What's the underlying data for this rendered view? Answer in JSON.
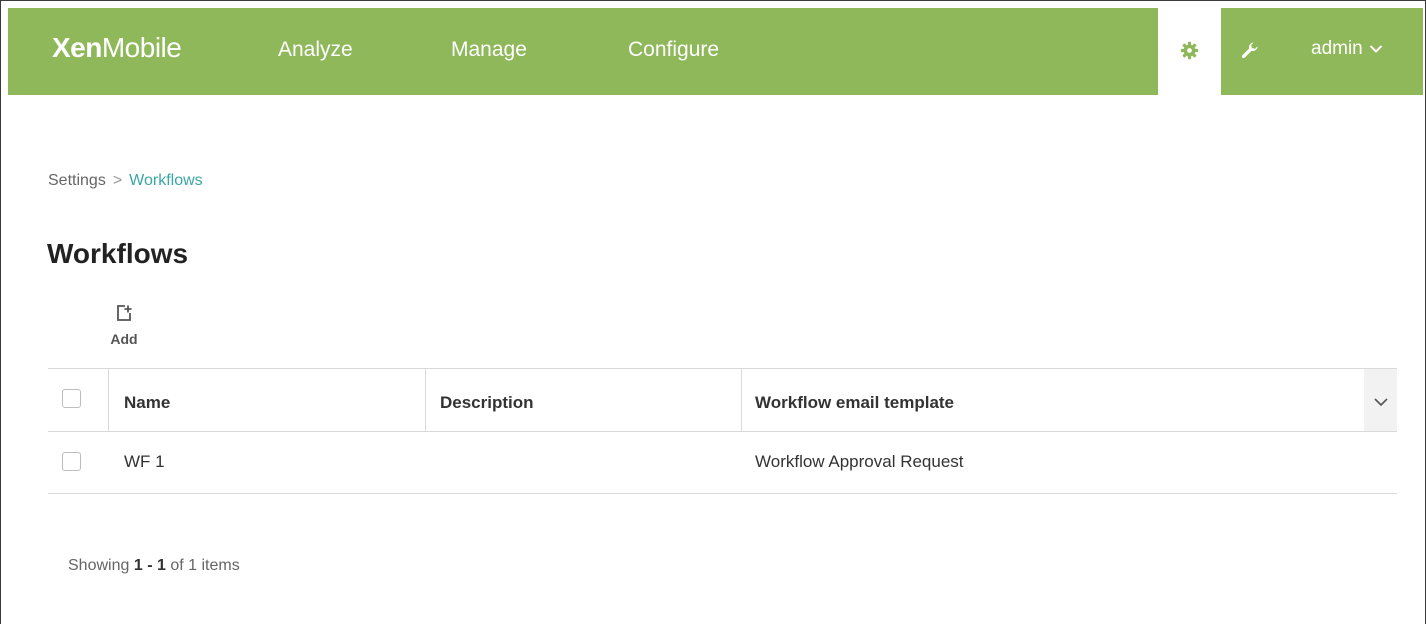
{
  "header": {
    "brand_bold": "Xen",
    "brand_rest": "Mobile",
    "nav": [
      "Analyze",
      "Manage",
      "Configure"
    ],
    "user": "admin",
    "accent_color": "#8fb85a"
  },
  "icons": {
    "settings": "gear-icon",
    "support": "wrench-icon",
    "user_menu": "chevron-down-icon",
    "add": "add-document-icon",
    "columns": "chevron-down-icon"
  },
  "breadcrumb": {
    "parent": "Settings",
    "separator": ">",
    "current": "Workflows"
  },
  "page": {
    "title": "Workflows",
    "add_label": "Add"
  },
  "table": {
    "columns": [
      "Name",
      "Description",
      "Workflow email template"
    ],
    "rows": [
      {
        "name": "WF 1",
        "description": "",
        "template": "Workflow Approval Request"
      }
    ]
  },
  "pagination": {
    "prefix": "Showing",
    "from": "1",
    "dash": "-",
    "to": "1",
    "of_text": "of 1 items"
  }
}
